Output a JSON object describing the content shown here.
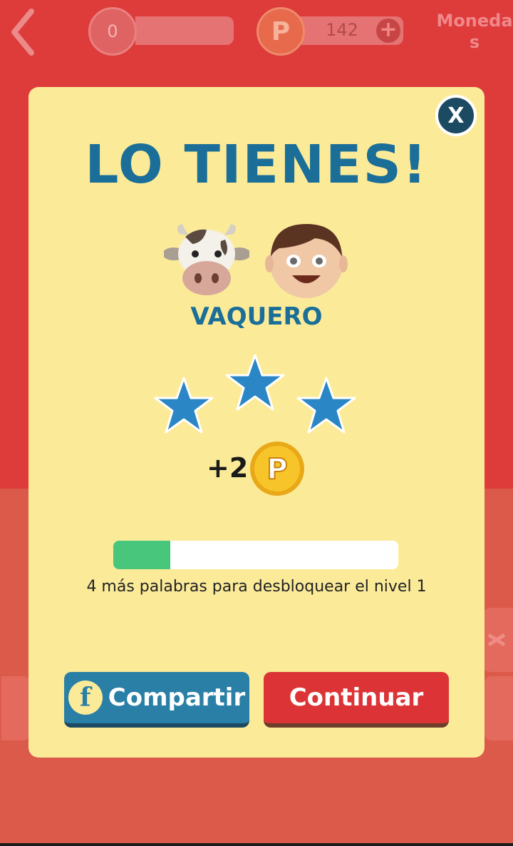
{
  "header": {
    "level_value": "0",
    "coin_symbol": "P",
    "coin_count": "142",
    "add_label": "+",
    "monedas_label": "Moneda\ns"
  },
  "modal": {
    "title": "LO TIENES!",
    "emoji": [
      "cow-face",
      "boy-face"
    ],
    "answer": "VAQUERO",
    "stars_earned": 3,
    "stars_total": 3,
    "reward_text": "+2",
    "reward_coin_symbol": "P",
    "progress_fraction": 0.2,
    "progress_text": "4 más palabras para desbloquear el nivel 1",
    "close_label": "X"
  },
  "buttons": {
    "share_icon_letter": "f",
    "share_label": "Compartir",
    "continue_label": "Continuar"
  },
  "colors": {
    "title_blue": "#1b6e98",
    "modal_bg": "#fbeb99",
    "share_bg": "#2a7fa6",
    "continue_bg": "#dc3436",
    "progress_fill": "#47c67c",
    "star_blue": "#2b86c6"
  }
}
